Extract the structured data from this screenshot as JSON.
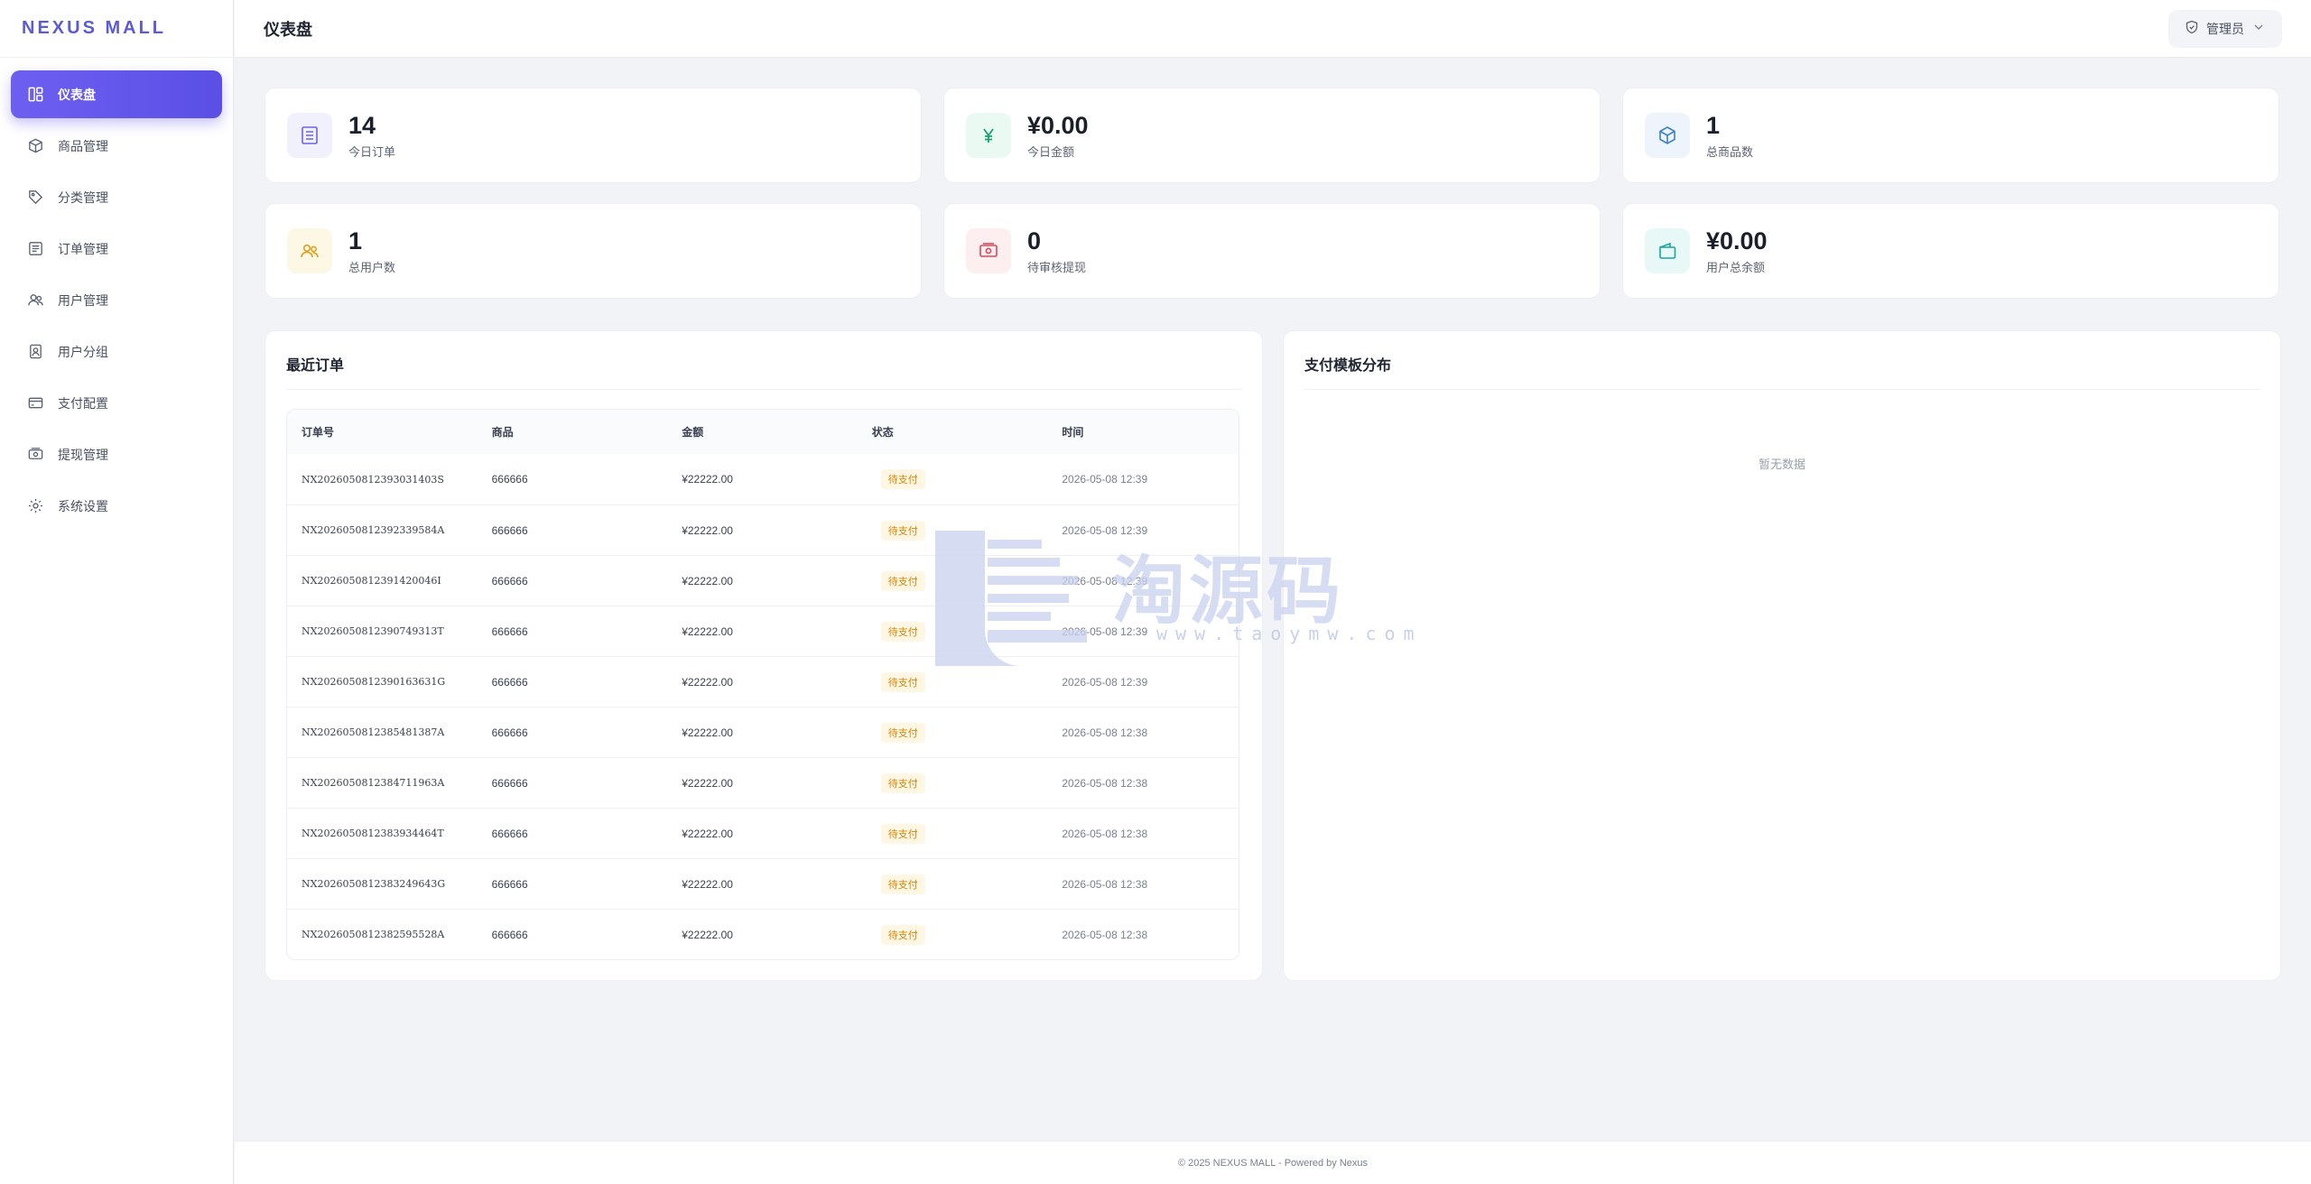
{
  "brand": "NEXUS MALL",
  "sidebar": {
    "items": [
      {
        "label": "仪表盘",
        "icon": "dashboard-icon",
        "active": true
      },
      {
        "label": "商品管理",
        "icon": "box-icon"
      },
      {
        "label": "分类管理",
        "icon": "tag-icon"
      },
      {
        "label": "订单管理",
        "icon": "list-icon"
      },
      {
        "label": "用户管理",
        "icon": "users-icon"
      },
      {
        "label": "用户分组",
        "icon": "user-badge-icon"
      },
      {
        "label": "支付配置",
        "icon": "card-icon"
      },
      {
        "label": "提现管理",
        "icon": "cash-icon"
      },
      {
        "label": "系统设置",
        "icon": "gear-icon"
      }
    ]
  },
  "header": {
    "title": "仪表盘",
    "user_label": "管理员"
  },
  "stats": [
    {
      "value": "14",
      "label": "今日订单",
      "icon": "document-icon",
      "color": "#6c63e8",
      "bg": "#f1f0fd"
    },
    {
      "value": "¥0.00",
      "label": "今日金额",
      "icon": "yen-icon",
      "color": "#1aa36f",
      "bg": "#eafaf2"
    },
    {
      "value": "1",
      "label": "总商品数",
      "icon": "cube-icon",
      "color": "#3b82c4",
      "bg": "#eef4fb"
    },
    {
      "value": "1",
      "label": "总用户数",
      "icon": "users-icon",
      "color": "#e0a019",
      "bg": "#fdf7e6"
    },
    {
      "value": "0",
      "label": "待审核提现",
      "icon": "cash-icon",
      "color": "#d9485a",
      "bg": "#fdeef0"
    },
    {
      "value": "¥0.00",
      "label": "用户总余额",
      "icon": "wallet-icon",
      "color": "#18a79a",
      "bg": "#e8f8f6"
    }
  ],
  "recent_orders": {
    "title": "最近订单",
    "columns": [
      "订单号",
      "商品",
      "金额",
      "状态",
      "时间"
    ],
    "rows": [
      {
        "id": "NX2026050812393031403S",
        "product": "666666",
        "amount": "¥22222.00",
        "status": "待支付",
        "time": "2026-05-08 12:39"
      },
      {
        "id": "NX2026050812392339584A",
        "product": "666666",
        "amount": "¥22222.00",
        "status": "待支付",
        "time": "2026-05-08 12:39"
      },
      {
        "id": "NX2026050812391420046I",
        "product": "666666",
        "amount": "¥22222.00",
        "status": "待支付",
        "time": "2026-05-08 12:39"
      },
      {
        "id": "NX2026050812390749313T",
        "product": "666666",
        "amount": "¥22222.00",
        "status": "待支付",
        "time": "2026-05-08 12:39"
      },
      {
        "id": "NX2026050812390163631G",
        "product": "666666",
        "amount": "¥22222.00",
        "status": "待支付",
        "time": "2026-05-08 12:39"
      },
      {
        "id": "NX2026050812385481387A",
        "product": "666666",
        "amount": "¥22222.00",
        "status": "待支付",
        "time": "2026-05-08 12:38"
      },
      {
        "id": "NX2026050812384711963A",
        "product": "666666",
        "amount": "¥22222.00",
        "status": "待支付",
        "time": "2026-05-08 12:38"
      },
      {
        "id": "NX2026050812383934464T",
        "product": "666666",
        "amount": "¥22222.00",
        "status": "待支付",
        "time": "2026-05-08 12:38"
      },
      {
        "id": "NX2026050812383249643G",
        "product": "666666",
        "amount": "¥22222.00",
        "status": "待支付",
        "time": "2026-05-08 12:38"
      },
      {
        "id": "NX2026050812382595528A",
        "product": "666666",
        "amount": "¥22222.00",
        "status": "待支付",
        "time": "2026-05-08 12:38"
      }
    ]
  },
  "payment_dist": {
    "title": "支付模板分布",
    "empty_text": "暂无数据"
  },
  "watermark": {
    "text": "淘源码",
    "url": "www.taoymw.com"
  },
  "footer": "© 2025 NEXUS MALL - Powered by Nexus",
  "colors": {
    "accent": "#5b4fe6",
    "pending_badge_bg": "#fff6e3",
    "pending_badge_text": "#d48806"
  }
}
